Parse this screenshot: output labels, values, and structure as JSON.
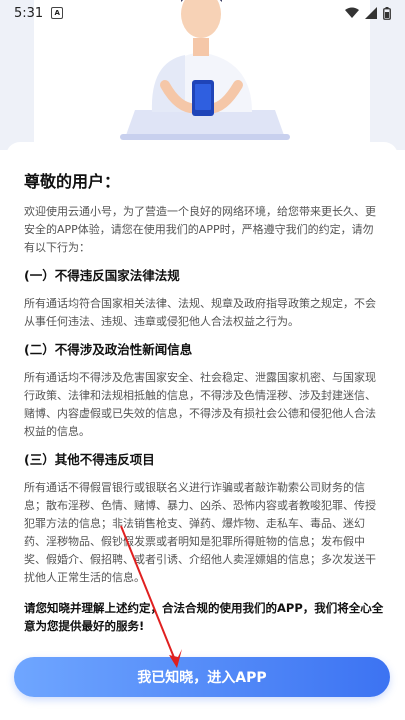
{
  "status_bar": {
    "time": "5:31",
    "notification_badge": "A",
    "icons": [
      "wifi-icon",
      "cellular-icon",
      "battery-icon"
    ]
  },
  "hero": {
    "illustration": "person-with-phone-illustration"
  },
  "notice": {
    "title": "尊敬的用户：",
    "intro": "欢迎使用云通小号，为了营造一个良好的网络环境，给您带来更长久、更安全的APP体验，请您在使用我们的APP时，严格遵守我们的约定，请勿有以下行为：",
    "sections": [
      {
        "heading": "(一）不得违反国家法律法规",
        "body": "所有通话均符合国家相关法律、法规、规章及政府指导政策之规定，不会从事任何违法、违规、违章或侵犯他人合法权益之行为。"
      },
      {
        "heading": "(二）不得涉及政治性新闻信息",
        "body": "所有通话均不得涉及危害国家安全、社会稳定、泄露国家机密、与国家现行政策、法律和法规相抵触的信息，不得涉及色情淫秽、涉及封建迷信、赌博、内容虚假或已失效的信息，不得涉及有损社会公德和侵犯他人合法权益的信息。"
      },
      {
        "heading": "(三）其他不得违反项目",
        "body": "所有通话不得假冒银行或银联名义进行诈骗或者敲诈勒索公司财务的信息；散布淫秽、色情、赌博、暴力、凶杀、恐怖内容或者教唆犯罪、传授犯罪方法的信息；非法销售枪支、弹药、爆炸物、走私车、毒品、迷幻药、淫秽物品、假钞假发票或者明知是犯罪所得赃物的信息；发布假中奖、假婚介、假招聘、或者引诱、介绍他人卖淫嫖娼的信息；多次发送干扰他人正常生活的信息。"
      }
    ],
    "agreement": "请您知晓并理解上述约定，合法合规的使用我们的APP，我们将全心全意为您提供最好的服务!"
  },
  "button": {
    "label": "我已知晓，进入APP"
  },
  "colors": {
    "button_gradient_start": "#6fa6ff",
    "button_gradient_end": "#3c73f2",
    "annotation_arrow": "#e02020"
  }
}
